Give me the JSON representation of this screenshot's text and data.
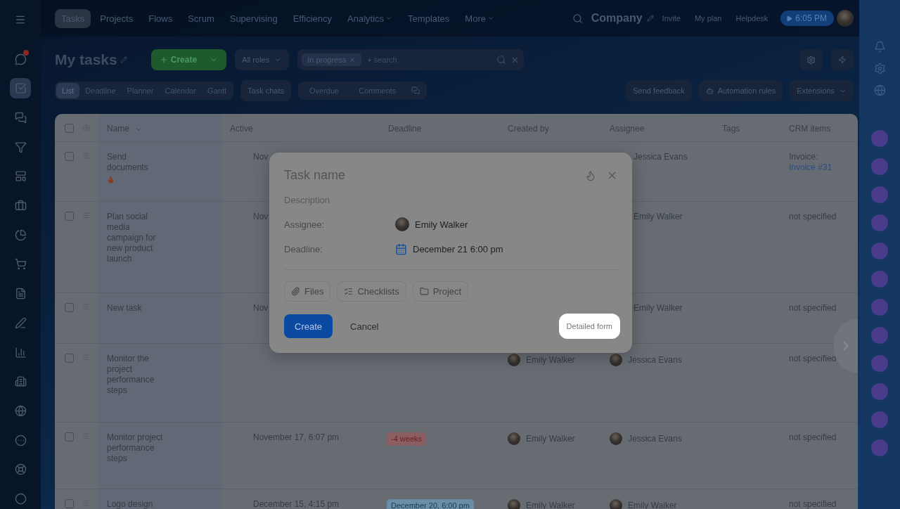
{
  "nav": {
    "tabs": [
      {
        "label": "Tasks",
        "selected": true
      },
      {
        "label": "Projects",
        "selected": false
      },
      {
        "label": "Flows",
        "selected": false
      },
      {
        "label": "Scrum",
        "selected": false
      },
      {
        "label": "Supervising",
        "selected": false
      },
      {
        "label": "Efficiency",
        "selected": false
      },
      {
        "label": "Analytics",
        "selected": false,
        "menu": true
      },
      {
        "label": "Templates",
        "selected": false
      },
      {
        "label": "More",
        "selected": false,
        "menu": true
      }
    ],
    "company": "Company",
    "links": [
      "Invite",
      "My plan",
      "Helpdesk"
    ],
    "clock": "6:05 PM"
  },
  "header": {
    "title": "My tasks",
    "create": "Create",
    "roles": "All roles",
    "filter_chip": "In progress",
    "search": {
      "placeholder": "+ search"
    }
  },
  "views": [
    {
      "label": "List",
      "selected": true
    },
    {
      "label": "Deadline",
      "selected": false
    },
    {
      "label": "Planner",
      "selected": false
    },
    {
      "label": "Calendar",
      "selected": false
    },
    {
      "label": "Gantt",
      "selected": false
    }
  ],
  "task_chats": "Task chats",
  "counters": [
    "Overdue",
    "Comments"
  ],
  "actions": [
    "Send feedback",
    "Automation rules",
    "Extensions"
  ],
  "table": {
    "all_checked": false,
    "columns": [
      "Name",
      "Active",
      "Deadline",
      "Created by",
      "Assignee",
      "Tags",
      "CRM items"
    ],
    "rows": [
      {
        "checked": false,
        "name": "Send documents",
        "flame": true,
        "active": "Nov",
        "assignee": {
          "name": "Jessica Evans",
          "avatar": false
        },
        "crm": {
          "label": "Invoice:",
          "link": "Invoice #31"
        }
      },
      {
        "checked": false,
        "name": "Plan social media campaign for new product launch",
        "active": "Nov",
        "assignee": {
          "name": "Emily Walker",
          "avatar": false
        },
        "crm": {
          "label": "not specified"
        }
      },
      {
        "checked": false,
        "name": "New task",
        "active": "Nov",
        "assignee": {
          "name": "Emily Walker",
          "avatar": false
        },
        "crm": {
          "label": "not specified"
        }
      },
      {
        "checked": false,
        "name": "Monitor the project performance steps",
        "created_by": "Emily Walker",
        "assignee": {
          "name": "Jessica Evans",
          "avatar": true
        },
        "crm": {
          "label": "not specified"
        }
      },
      {
        "checked": false,
        "name": "Monitor project performance steps",
        "active": "November 17, 6:07 pm",
        "deadline": {
          "text": "-4 weeks",
          "kind": "overdue"
        },
        "created_by": "Emily Walker",
        "assignee": {
          "name": "Jessica Evans",
          "avatar": true
        },
        "crm": {
          "label": "not specified"
        }
      },
      {
        "checked": false,
        "name": "Logo design",
        "active": "December 15, 4:15 pm",
        "deadline": {
          "text": "December 20, 6:00 pm",
          "kind": "upcoming"
        },
        "created_by": "Emily Walker",
        "assignee": {
          "name": "Emily Walker",
          "avatar": true
        },
        "crm": {
          "label": "not specified"
        }
      }
    ]
  },
  "modal": {
    "title_placeholder": "Task name",
    "description_placeholder": "Description",
    "fields": [
      {
        "label": "Assignee:",
        "value": "Emily Walker",
        "kind": "person"
      },
      {
        "label": "Deadline:",
        "value": "December 21 6:00 pm",
        "kind": "date"
      }
    ],
    "chips": [
      {
        "label": "Files",
        "kind": "files"
      },
      {
        "label": "Checklists",
        "kind": "checklist"
      },
      {
        "label": "Project",
        "kind": "project"
      }
    ],
    "create": "Create",
    "cancel": "Cancel",
    "detailed": "Detailed form"
  }
}
